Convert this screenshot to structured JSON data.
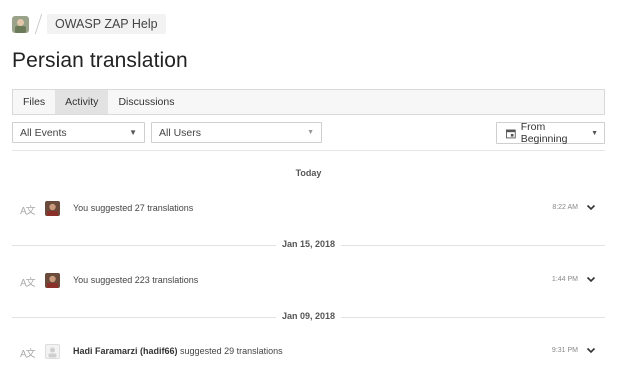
{
  "breadcrumb": {
    "project": "OWASP ZAP Help"
  },
  "page": {
    "title": "Persian translation"
  },
  "tabs": [
    {
      "label": "Files",
      "active": false
    },
    {
      "label": "Activity",
      "active": true
    },
    {
      "label": "Discussions",
      "active": false
    }
  ],
  "filters": {
    "events": "All Events",
    "users": "All Users",
    "date_range": "From Beginning"
  },
  "groups": [
    {
      "date": "Today",
      "entry": {
        "actor": "You",
        "text": "You suggested 27 translations",
        "time": "8:22 AM",
        "avatar": "user-photo"
      }
    },
    {
      "date": "Jan 15, 2018",
      "entry": {
        "actor": "You",
        "text": "You suggested 223 translations",
        "time": "1:44 PM",
        "avatar": "user-photo"
      }
    },
    {
      "date": "Jan 09, 2018",
      "entry": {
        "actor": "Hadi Faramarzi (hadif66)",
        "text": "suggested 29 translations",
        "time": "9:31 PM",
        "avatar": "default-avatar"
      }
    }
  ],
  "icons": {
    "translation": "translation-icon",
    "calendar": "calendar-icon",
    "chevron": "chevron-down-icon"
  },
  "colors": {
    "tab_active_bg": "#e2e2e2",
    "tab_bar_bg": "#f7f7f7",
    "border": "#d9d9d9"
  }
}
